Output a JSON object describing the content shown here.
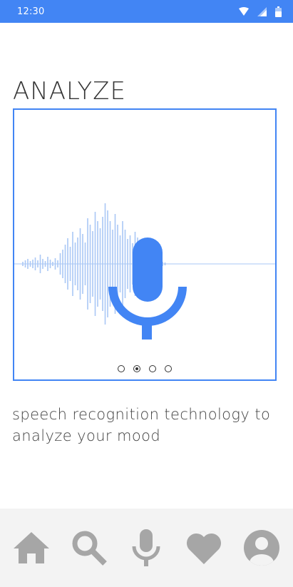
{
  "status_bar": {
    "time": "12:30",
    "background": "#4285f4",
    "icons": [
      "wifi-icon",
      "signal-icon",
      "battery-icon"
    ]
  },
  "page": {
    "title": "ANALYZE",
    "description": "speech recognition technology to analyze your mood"
  },
  "carousel": {
    "illustration": "microphone-waveform",
    "accent_color": "#4285f4",
    "wave_color": "#a9c7f5",
    "page_count": 4,
    "active_page": 2
  },
  "bottom_nav": {
    "background": "#f3f3f3",
    "icon_color": "#a6a6a6",
    "items": [
      "home-icon",
      "search-icon",
      "microphone-icon",
      "heart-icon",
      "profile-icon"
    ]
  }
}
